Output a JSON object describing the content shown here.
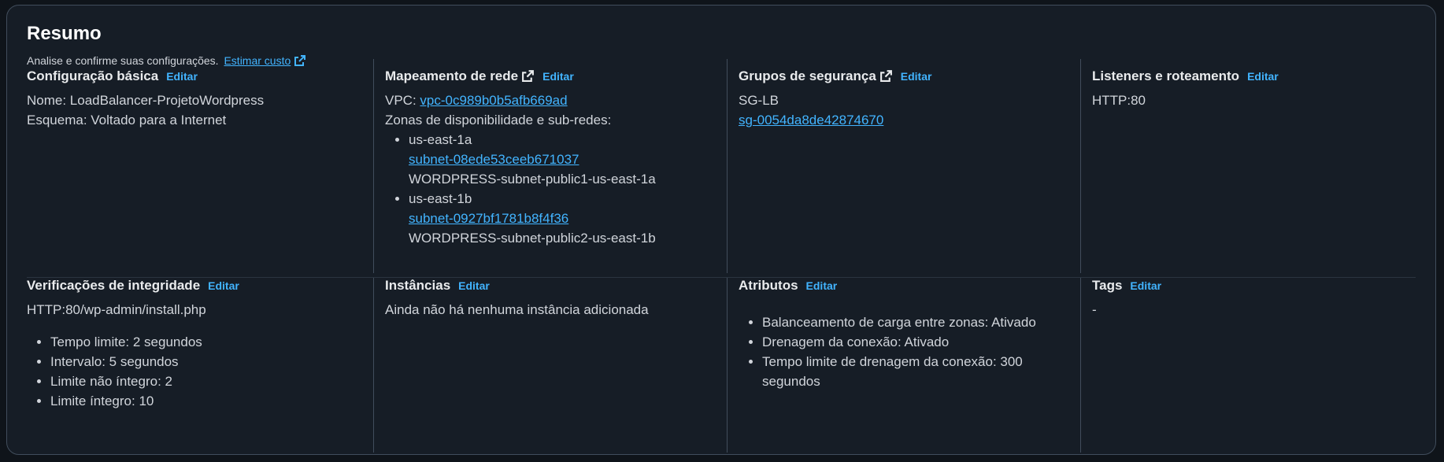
{
  "summary": {
    "title": "Resumo",
    "subtitle": "Analise e confirme suas configurações.",
    "estimate_link": "Estimar custo"
  },
  "edit_label": "Editar",
  "basic": {
    "title": "Configuração básica",
    "name": "Nome: LoadBalancer-ProjetoWordpress",
    "scheme": "Esquema: Voltado para a Internet"
  },
  "network": {
    "title": "Mapeamento de rede",
    "vpc_prefix": "VPC:",
    "vpc_id": "vpc-0c989b0b5afb669ad",
    "zones_label": "Zonas de disponibilidade e sub-redes:",
    "zones": [
      {
        "az": "us-east-1a",
        "subnet": "subnet-08ede53ceeb671037",
        "subnet_name": "WORDPRESS-subnet-public1-us-east-1a"
      },
      {
        "az": "us-east-1b",
        "subnet": "subnet-0927bf1781b8f4f36",
        "subnet_name": "WORDPRESS-subnet-public2-us-east-1b"
      }
    ]
  },
  "security": {
    "title": "Grupos de segurança",
    "group_name": "SG-LB",
    "group_id": "sg-0054da8de42874670"
  },
  "listeners": {
    "title": "Listeners e roteamento",
    "value": "HTTP:80"
  },
  "health": {
    "title": "Verificações de integridade",
    "path": "HTTP:80/wp-admin/install.php",
    "items": [
      "Tempo limite: 2 segundos",
      "Intervalo: 5 segundos",
      "Limite não íntegro: 2",
      "Limite íntegro: 10"
    ]
  },
  "instances": {
    "title": "Instâncias",
    "value": "Ainda não há nenhuma instância adicionada"
  },
  "attributes": {
    "title": "Atributos",
    "items": [
      "Balanceamento de carga entre zonas: Ativado",
      "Drenagem da conexão: Ativado",
      "Tempo limite de drenagem da conexão: 300",
      "segundos"
    ]
  },
  "tags": {
    "title": "Tags",
    "value": "-"
  },
  "colors": {
    "background": "#0f141a",
    "panel": "#161d26",
    "border": "#414d5c",
    "link": "#42b4ff",
    "text": "#d1d5db"
  }
}
